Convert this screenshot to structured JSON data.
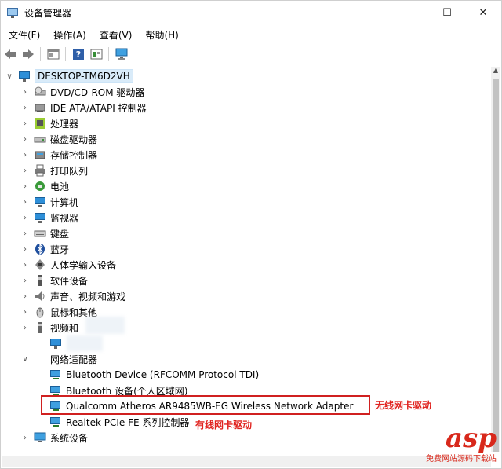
{
  "window": {
    "title": "设备管理器",
    "controls": {
      "minimize": "—",
      "maximize": "☐",
      "close": "✕"
    }
  },
  "menu": [
    "文件(F)",
    "操作(A)",
    "查看(V)",
    "帮助(H)"
  ],
  "tree": {
    "root": "DESKTOP-TM6D2VH",
    "categories": [
      {
        "label": "DVD/CD-ROM 驱动器",
        "icon": "disc-drive-icon"
      },
      {
        "label": "IDE ATA/ATAPI 控制器",
        "icon": "ide-controller-icon"
      },
      {
        "label": "处理器",
        "icon": "processor-icon"
      },
      {
        "label": "磁盘驱动器",
        "icon": "disk-drive-icon"
      },
      {
        "label": "存储控制器",
        "icon": "storage-controller-icon"
      },
      {
        "label": "打印队列",
        "icon": "printer-icon"
      },
      {
        "label": "电池",
        "icon": "battery-icon"
      },
      {
        "label": "计算机",
        "icon": "computer-icon"
      },
      {
        "label": "监视器",
        "icon": "monitor-icon"
      },
      {
        "label": "键盘",
        "icon": "keyboard-icon"
      },
      {
        "label": "蓝牙",
        "icon": "bluetooth-icon"
      },
      {
        "label": "人体学输入设备",
        "icon": "hid-icon"
      },
      {
        "label": "软件设备",
        "icon": "software-device-icon"
      },
      {
        "label": "声音、视频和游戏",
        "icon": "sound-icon"
      },
      {
        "label": "鼠标和其他",
        "icon": "mouse-icon"
      },
      {
        "label": "视频和",
        "icon": "video-icon"
      }
    ],
    "network_category": "网络适配器",
    "network_adapters": [
      "Bluetooth Device (RFCOMM Protocol TDI)",
      "Bluetooth 设备(个人区域网)",
      "Qualcomm Atheros AR9485WB-EG Wireless Network Adapter",
      "Realtek PCIe FE 系列控制器"
    ],
    "after": "系统设备"
  },
  "annotations": {
    "wireless": "无线网卡驱动",
    "wired": "有线网卡驱动"
  },
  "watermark": {
    "brand": "asp",
    "site": "免费网站源码下载站"
  },
  "colors": {
    "accent": "#d02020",
    "selection": "#d9ebf9"
  }
}
